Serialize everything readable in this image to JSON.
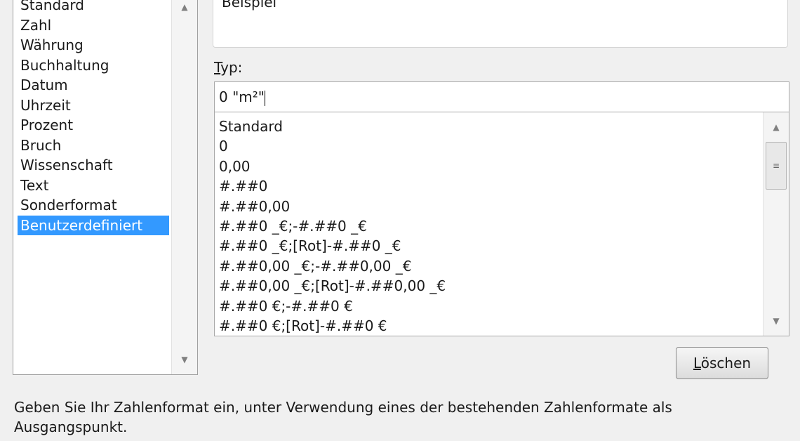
{
  "categories": {
    "items": [
      "Standard",
      "Zahl",
      "Währung",
      "Buchhaltung",
      "Datum",
      "Uhrzeit",
      "Prozent",
      "Bruch",
      "Wissenschaft",
      "Text",
      "Sonderformat",
      "Benutzerdefiniert"
    ],
    "selected": "Benutzerdefiniert"
  },
  "sample": {
    "label": "Beispiel"
  },
  "type": {
    "label_mnemonic": "T",
    "label_rest": "yp:",
    "value": "0 \"m²\"",
    "formats": [
      "Standard",
      "0",
      "0,00",
      "#.##0",
      "#.##0,00",
      "#.##0 _€;-#.##0 _€",
      "#.##0 _€;[Rot]-#.##0 _€",
      "#.##0,00 _€;-#.##0,00 _€",
      "#.##0,00 _€;[Rot]-#.##0,00 _€",
      "#.##0 €;-#.##0 €",
      "#.##0 €;[Rot]-#.##0 €"
    ]
  },
  "delete_button": {
    "mnemonic": "L",
    "rest": "öschen"
  },
  "description": "Geben Sie Ihr Zahlenformat ein, unter Verwendung eines der bestehenden Zahlenformate als Ausgangspunkt.",
  "colors": {
    "selection": "#3399ff"
  }
}
